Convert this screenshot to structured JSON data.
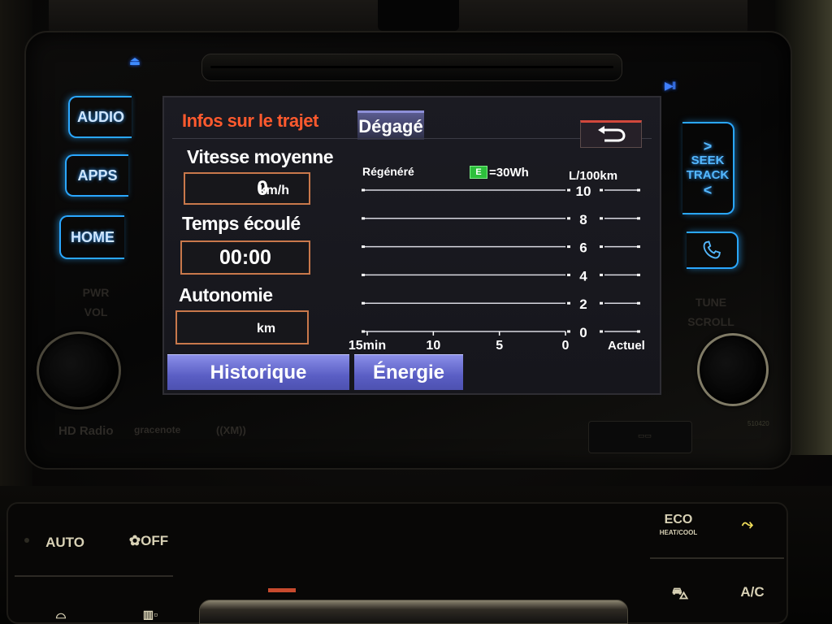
{
  "head_unit": {
    "left_buttons": [
      {
        "label": "AUDIO"
      },
      {
        "label": "APPS"
      },
      {
        "label": "HOME"
      }
    ],
    "right_buttons": {
      "seek_track": {
        "line1": "SEEK",
        "line2": "TRACK",
        "next": ">",
        "prev": "<"
      },
      "phone_icon": "phone-icon"
    },
    "eject_icon": "⏏",
    "play_pause_icon": "▶II",
    "pwr_vol_label": [
      "PWR",
      "VOL"
    ],
    "tune_scroll_label": [
      "TUNE",
      "SCROLL"
    ],
    "logos": {
      "hd_radio": "HD Radio",
      "gracenote": "gracenote",
      "xm": "((XM))"
    },
    "model_code": "510420"
  },
  "screen": {
    "title": "Infos sur le trajet",
    "active_tab": "Dégagé",
    "back_icon": "⮌",
    "average_speed": {
      "label": "Vitesse moyenne",
      "value": "0",
      "unit": "km/h"
    },
    "elapsed_time": {
      "label": "Temps écoulé",
      "value": "00:00"
    },
    "range": {
      "label": "Autonomie",
      "value": "",
      "unit": "km"
    },
    "bottom_tabs": [
      {
        "label": "Historique"
      },
      {
        "label": "Énergie"
      }
    ],
    "colors": {
      "title": "#ff5a2e",
      "box_border": "#c9784b",
      "tab_blue": "#6a6ed6",
      "legend_green": "#2dbf3c"
    }
  },
  "chart_data": {
    "type": "bar",
    "title": "",
    "regen_label": "Régénéré",
    "legend": {
      "icon_label": "E",
      "text": "=30Wh"
    },
    "ylabel": "L/100km",
    "xlabel": "",
    "ylim": [
      0,
      10
    ],
    "y_ticks": [
      "10",
      "8",
      "6",
      "4",
      "2",
      "0"
    ],
    "x_ticks": [
      "15min",
      "10",
      "5",
      "0"
    ],
    "current_label": "Actuel",
    "categories": [
      "15min",
      "10",
      "5",
      "0"
    ],
    "values": [
      0,
      0,
      0,
      0
    ],
    "current_value": 0,
    "regen_counts": [
      0,
      0,
      0,
      0
    ],
    "grid": true
  },
  "climate": {
    "auto_label": "AUTO",
    "fan_off_label": "OFF",
    "eco_label": "ECO",
    "eco_sub_label": "HEAT/COOL",
    "ac_label": "A/C",
    "icons": [
      "fan-icon",
      "seat-vent-icon",
      "recirculate-icon",
      "front-defrost-icon",
      "rear-defrost-icon"
    ]
  }
}
